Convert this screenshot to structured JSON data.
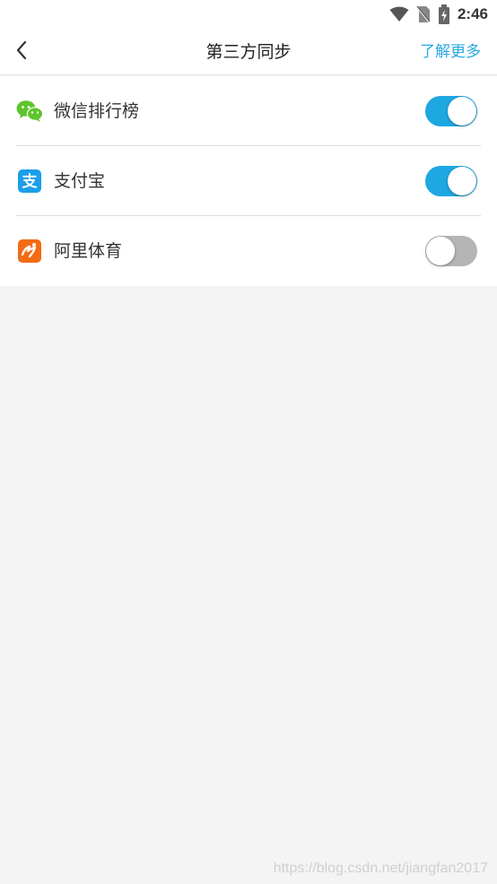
{
  "status_bar": {
    "time": "2:46",
    "icons": [
      "wifi-icon",
      "no-sim-icon",
      "battery-charging-icon"
    ]
  },
  "header": {
    "title": "第三方同步",
    "back_icon": "chevron-left-icon",
    "more_label": "了解更多",
    "accent_color": "#2aa7e0"
  },
  "sync_items": [
    {
      "label": "微信排行榜",
      "icon": "wechat-icon",
      "enabled": true,
      "icon_color": "#5ec42b"
    },
    {
      "label": "支付宝",
      "icon": "alipay-icon",
      "enabled": true,
      "icon_color": "#1a9fe8"
    },
    {
      "label": "阿里体育",
      "icon": "ali-sports-icon",
      "enabled": false,
      "icon_color": "#f36b13"
    }
  ],
  "toggle_colors": {
    "on": "#1ea8e2",
    "off": "#b5b5b5"
  },
  "watermark": "https://blog.csdn.net/jiangfan2017"
}
